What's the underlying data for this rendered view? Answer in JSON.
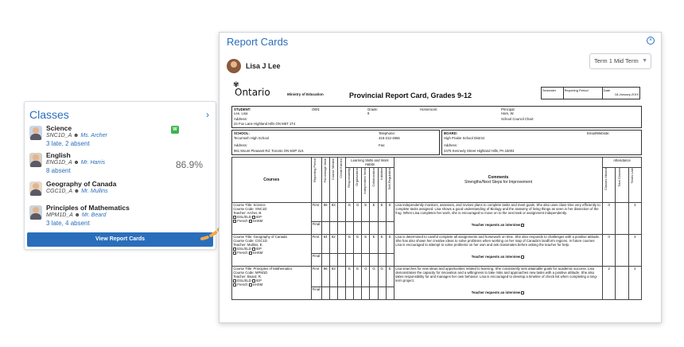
{
  "classes_card": {
    "title": "Classes",
    "items": [
      {
        "name": "Science",
        "code": "SNC1D_A",
        "teacher": "Ms. Archer",
        "status": "3 late, 2 absent",
        "badge": "W",
        "grade": ""
      },
      {
        "name": "English",
        "code": "ENG1D_A",
        "teacher": "Mr. Harris",
        "status": "8 absent",
        "badge": "",
        "grade": "86.9%"
      },
      {
        "name": "Geography of Canada",
        "code": "CGC1D_A",
        "teacher": "Mr. Mullins",
        "status": "",
        "badge": "",
        "grade": ""
      },
      {
        "name": "Principles of Mathematics",
        "code": "MPM1D_A",
        "teacher": "Mr. Beard",
        "status": "3 late, 4 absent",
        "badge": "",
        "grade": ""
      }
    ],
    "button": "View Report Cards"
  },
  "report": {
    "title": "Report Cards",
    "student": "Lisa J Lee",
    "term": "Term 1 Mid Term",
    "doc": {
      "logo": "Ontario",
      "ministry": "Ministry of Education",
      "heading": "Provincial Report Card, Grades 9-12",
      "semester_label": "Semester",
      "period_label": "Reporting Period",
      "date_label": "Date",
      "date": "18-January-2019",
      "student_label": "STUDENT:",
      "student_value": "Lee, Lisa",
      "oen_label": "OEN:",
      "grade_label": "Grade:",
      "grade_value": "9",
      "homeroom_label": "Homeroom:",
      "principal_label": "Principal:",
      "principal_value": "Ham, W.",
      "address_label": "Address:",
      "address_value": "24 Fox Lane Highland Hills ON M5T 1T4",
      "council_label": "School Council Chair:",
      "school_label": "SCHOOL:",
      "school_value": "Tecumseh High School",
      "telephone_label": "Telephone:",
      "telephone_value": "416-212-4556",
      "school_address_value": "961 Mount Pleasant Rd. Toronto ON M4P 2L5",
      "fax_label": "Fax:",
      "board_label": "BOARD:",
      "board_value": "High Prairie School District",
      "email_label": "Email/Website:",
      "board_address_value": "2475 Kennedy Street Highland Hills, PA 15004",
      "courses_header": "Courses",
      "learning_skills_header": "Learning Skills and Work Habits",
      "attendance_header": "Attendance",
      "comments_header": "Comments",
      "comments_sub": "Strengths/Next Steps for Improvement",
      "col_reporting_period": "Reporting Period",
      "col_percentage": "Percentage Mark",
      "col_median": "Course Median",
      "col_credit": "Credit Earned",
      "col_responsibility": "Responsibility",
      "col_organization": "Organization",
      "col_independent": "Independent Work",
      "col_collaboration": "Collaboration",
      "col_initiative": "Initiative",
      "col_self_reg": "Self-Regulation",
      "col_classes_missed": "Classes Missed",
      "col_total_classes": "Total Classes",
      "col_times_late": "Times Late",
      "esl_label": "ESL/ELD",
      "iep_label": "IEP",
      "french_label": "French",
      "shsm_label": "SHSM",
      "first_label": "First",
      "final_label": "Final",
      "interview_label": "Teacher requests an interview",
      "courses": [
        {
          "title": "Course Title: Science",
          "code": "Course Code: SNC1D",
          "teacher": "Teacher: Archer, B.",
          "mark": "96",
          "median": "83",
          "skills": [
            "E",
            "G",
            "E",
            "E",
            "E",
            "E"
          ],
          "comment": "Lisa independently monitors, assesses, and revises plans to complete tasks and meet goals. She also uses class time very efficiently to complete tasks assigned. Lisa shows a good understanding of Biology and the anatomy of living things as seen in her dissection of the frog. When Lisa completes her work, she is encouraged to move on to the next task or assignment independently.",
          "missed": "0",
          "late": "3"
        },
        {
          "title": "Course Title: Geography of Canada",
          "code": "Course Code: CGC1D",
          "teacher": "Teacher: Mullins, E.",
          "mark": "94",
          "median": "82",
          "skills": [
            "E",
            "E",
            "E",
            "E",
            "E",
            "E"
          ],
          "comment": "Lisa is determined to careful complete all assignments and homework on time. She also responds to challenges with a positive attitude. She has also shown her creative ideas to solve problems when working on her map of Canada's landform regions. In future courses Lisa is encouraged to attempt to solve problems on her own and ask classmates before asking the teacher for help.",
          "missed": "0",
          "late": "3"
        },
        {
          "title": "Course Title: Principles of Mathematics",
          "code": "Course Code: MPM1D",
          "teacher": "Teacher: Beard, R.",
          "mark": "96",
          "median": "83",
          "skills": [
            "E",
            "E",
            "G",
            "G",
            "G",
            "E"
          ],
          "comment": "Lisa searches for new ideas and opportunities related to learning. She consistently sets attainable goals for academic success. Lisa demonstrates the capacity for innovation and a willingness to take risks and approaches new tasks with a positive attitude. She also takes responsibility for and manages her own behavior. Lisa is encouraged to develop a timeline of check list when completing a long-term project.",
          "missed": "2",
          "late": "2"
        }
      ]
    }
  }
}
